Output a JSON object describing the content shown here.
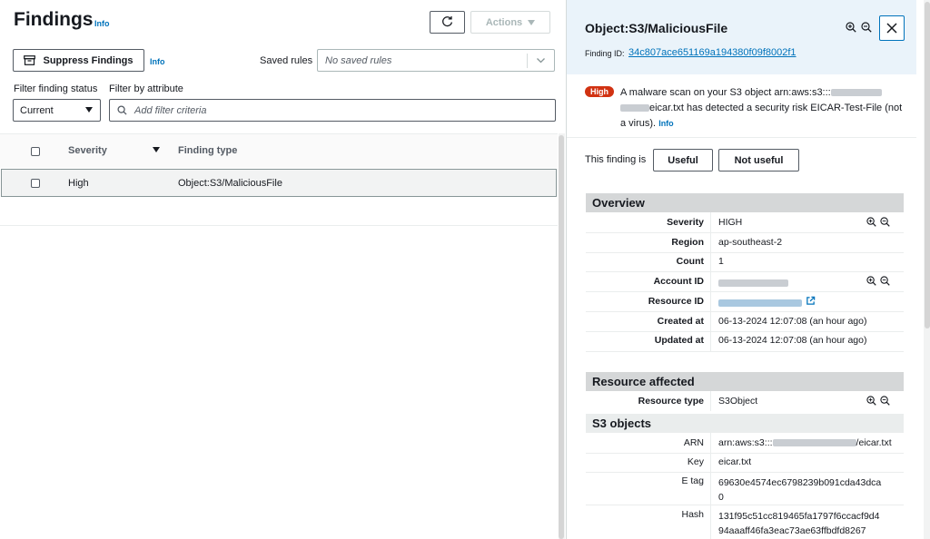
{
  "findings": {
    "title": "Findings",
    "title_info": "Info",
    "actions_label": "Actions",
    "suppress_label": "Suppress Findings",
    "suppress_info": "Info",
    "saved_rules_label": "Saved rules",
    "saved_rules_placeholder": "No saved rules",
    "filter_status_label": "Filter finding status",
    "filter_attr_label": "Filter by attribute",
    "status_value": "Current",
    "filter_placeholder": "Add filter criteria",
    "columns": [
      "Severity",
      "Finding type"
    ],
    "rows": [
      {
        "severity": "High",
        "finding_type": "Object:S3/MaliciousFile"
      }
    ]
  },
  "detail": {
    "title": "Object:S3/MaliciousFile",
    "finding_id_label": "Finding ID:",
    "finding_id": "34c807ace651169a194380f09f8002f1",
    "badge": "High",
    "alert_line1": "A malware scan on your S3 object arn:aws:s3:::",
    "alert_line2": "eicar.txt has detected a security risk EICAR-Test-File (not",
    "alert_line3": "a virus).",
    "alert_info": "Info",
    "useful_prompt": "This finding is",
    "useful": "Useful",
    "not_useful": "Not useful",
    "overview_title": "Overview",
    "overview": {
      "severity_key": "Severity",
      "severity": "HIGH",
      "region_key": "Region",
      "region": "ap-southeast-2",
      "count_key": "Count",
      "count": "1",
      "account_key": "Account ID",
      "resource_key": "Resource ID",
      "created_key": "Created at",
      "created": "06-13-2024 12:07:08 (an hour ago)",
      "updated_key": "Updated at",
      "updated": "06-13-2024 12:07:08 (an hour ago)"
    },
    "resource_title": "Resource affected",
    "resource_type_key": "Resource type",
    "resource_type": "S3Object",
    "s3_title": "S3 objects",
    "s3": {
      "arn_key": "ARN",
      "arn_prefix": "arn:aws:s3:::",
      "arn_suffix": "/eicar.txt",
      "key_key": "Key",
      "key": "eicar.txt",
      "etag_key": "E tag",
      "etag_1": "69630e4574ec6798239b091cda43dca",
      "etag_2": "0",
      "hash_key": "Hash",
      "hash_1": "131f95c51cc819465fa1797f6ccacf9d4",
      "hash_2": "94aaaff46fa3eac73ae63ffbdfd8267"
    }
  },
  "colors": {
    "link": "#0073bb",
    "high_badge": "#d13212",
    "header_bg": "#eaf3fa"
  }
}
